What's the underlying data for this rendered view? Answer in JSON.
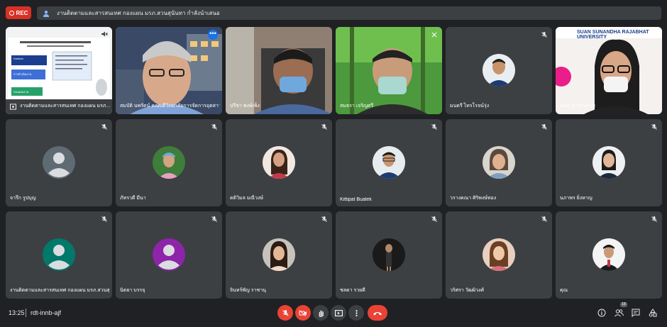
{
  "recording": {
    "label": "REC"
  },
  "presentation": {
    "title": "งานติดตามและสารสนเทศ กองแผน มรภ.สวนสุนันทา กำลังนำเสนอ"
  },
  "presentation_tile": {
    "name": "งานติดตามและสารสนเทศ กองแผน มรภ...",
    "slide_lines": [
      "Kanban",
      "ตัวชี้วัด",
      "การดำเนินงาน",
      "กองแผนงาน"
    ]
  },
  "participants": [
    {
      "name": "งานติดตามและสารสนเทศ กองแผน มรภ.สวนสุนันทา",
      "kind": "presentation"
    },
    {
      "name": "สมบัติ นพรัตน์ คณบดีวิทยาลัยการจัดการอุตสาหกรรมบริการ มรภ.สวนสุนันทา",
      "kind": "video"
    },
    {
      "name": "ปรีชา พงษ์เพ็ง",
      "kind": "video"
    },
    {
      "name": "สมธรา เจริญศรี",
      "kind": "video"
    },
    {
      "name": "มนตรี ไทรโรจน์รุ่ง",
      "kind": "avatar"
    },
    {
      "name": "สมพวง กล้าหาญ",
      "kind": "video"
    },
    {
      "name": "จารึก รูปบุญ",
      "kind": "generic"
    },
    {
      "name": "ภัทรวดี มีนา",
      "kind": "avatar"
    },
    {
      "name": "ดติวิมล มณีวงษ์",
      "kind": "avatar"
    },
    {
      "name": "Kittipat Bualek",
      "kind": "avatar"
    },
    {
      "name": "วรางคณา ศิริพงษ์ทอง",
      "kind": "avatar"
    },
    {
      "name": "นภาพร ยิ่งหาญ",
      "kind": "avatar"
    },
    {
      "name": "งานติดตามและสารสนเทศ กองแผน มรภ.สวนสุนันทา",
      "kind": "generic"
    },
    {
      "name": "นิตยา บรรจุ",
      "kind": "generic"
    },
    {
      "name": "จินทร์พัญ ราชานุ",
      "kind": "avatar"
    },
    {
      "name": "ชลดา รวยดี",
      "kind": "avatar"
    },
    {
      "name": "วริศรา วัฒผิวงศ์",
      "kind": "avatar"
    },
    {
      "name": "คุณ",
      "kind": "avatar"
    }
  ],
  "video_banner_text": "SUAN SUNANDHA RAJABHAT UNIVERSITY",
  "bottom": {
    "time": "13:25",
    "meeting_code": "rdt-innb-ajf",
    "participant_count": "18"
  },
  "colors": {
    "background": "#202124",
    "tile": "#3c4043",
    "accent_red": "#ea4335",
    "accent_blue": "#1a73e8",
    "avatar_teal": "#00796b",
    "avatar_purple": "#8e24aa",
    "avatar_slate": "#5f6b72"
  }
}
